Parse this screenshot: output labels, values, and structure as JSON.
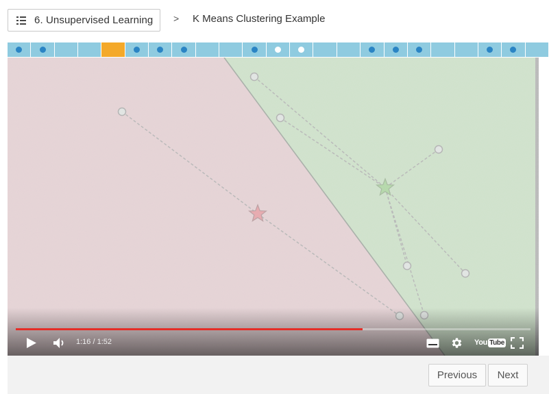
{
  "header": {
    "lesson_label": "6. Unsupervised Learning",
    "breadcrumb_separator": ">",
    "page_title": "K Means Clustering Example"
  },
  "segments": [
    {
      "state": "dot"
    },
    {
      "state": "dot"
    },
    {
      "state": "empty"
    },
    {
      "state": "empty"
    },
    {
      "state": "active"
    },
    {
      "state": "dot"
    },
    {
      "state": "dot"
    },
    {
      "state": "dot"
    },
    {
      "state": "empty"
    },
    {
      "state": "empty"
    },
    {
      "state": "dot"
    },
    {
      "state": "complete"
    },
    {
      "state": "complete"
    },
    {
      "state": "empty"
    },
    {
      "state": "empty"
    },
    {
      "state": "dot"
    },
    {
      "state": "dot"
    },
    {
      "state": "dot"
    },
    {
      "state": "empty"
    },
    {
      "state": "empty"
    },
    {
      "state": "dot"
    },
    {
      "state": "dot"
    },
    {
      "state": "empty"
    }
  ],
  "player": {
    "time_display": "1:16 / 1:52",
    "progress_fraction": 0.674,
    "logo_text_1": "You",
    "logo_text_2": "Tube"
  },
  "footer": {
    "previous_label": "Previous",
    "next_label": "Next"
  },
  "colors": {
    "accent_active": "#f4a92a",
    "segment": "#8fcbe0",
    "dot": "#2a84c4",
    "progress": "#e52d27",
    "cluster_red_region": "#c3979d",
    "cluster_green_region": "#8fbb86",
    "centroid_red": "#c8323e",
    "centroid_green": "#4ea435"
  }
}
